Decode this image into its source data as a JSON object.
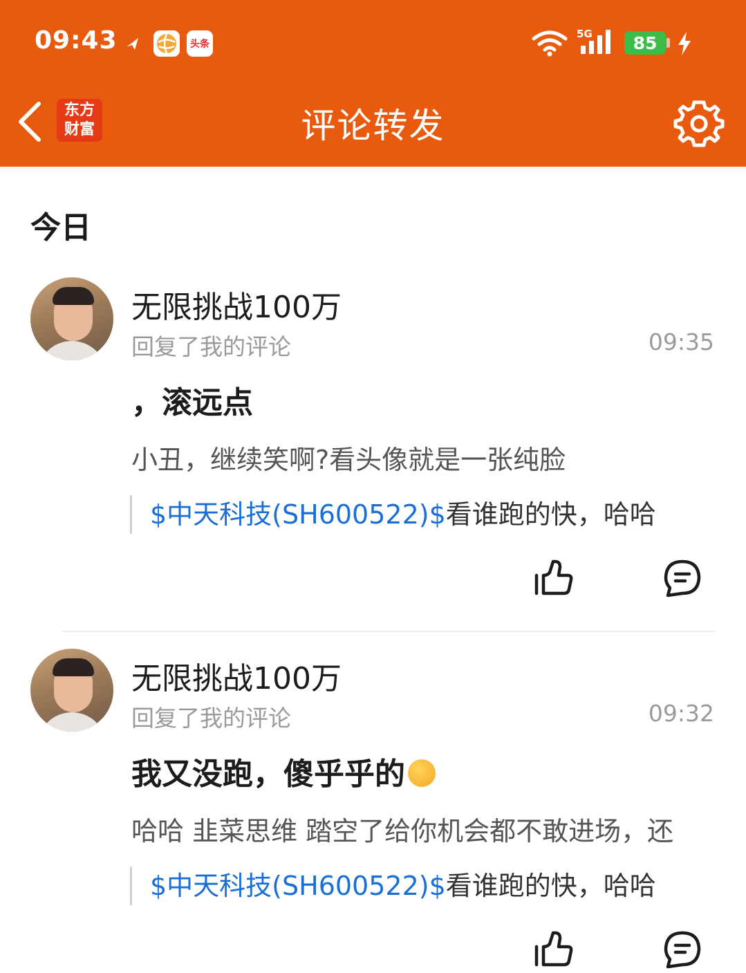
{
  "status_bar": {
    "time": "09:43",
    "notification_icons": [
      "feishu-icon",
      "ball-app-icon",
      "toutiao-icon"
    ],
    "toutiao_label": "头条",
    "network": "5G",
    "battery": "85",
    "charging": true
  },
  "nav": {
    "back_icon": "chevron-left-icon",
    "app_logo_line1": "东方",
    "app_logo_line2": "财富",
    "title": "评论转发",
    "settings_icon": "gear-icon"
  },
  "section": {
    "label": "今日"
  },
  "colors": {
    "header": "#e85a0e",
    "link": "#1a6fd6",
    "battery": "#3cbd4a"
  },
  "items": [
    {
      "user": "无限挑战100万",
      "action": "回复了我的评论",
      "time": "09:35",
      "reply": "，滚远点",
      "original": "小丑，继续笑啊?看头像就是一张纯脸",
      "quote_stock": "$中天科技(SH600522)$",
      "quote_text": "看谁跑的快，哈哈"
    },
    {
      "user": "无限挑战100万",
      "action": "回复了我的评论",
      "time": "09:32",
      "reply": "我又没跑，傻乎乎的",
      "reply_emoji": "sweat-smile-emoji",
      "original": "哈哈 韭菜思维 踏空了给你机会都不敢进场，还",
      "quote_stock": "$中天科技(SH600522)$",
      "quote_text": "看谁跑的快，哈哈"
    }
  ]
}
